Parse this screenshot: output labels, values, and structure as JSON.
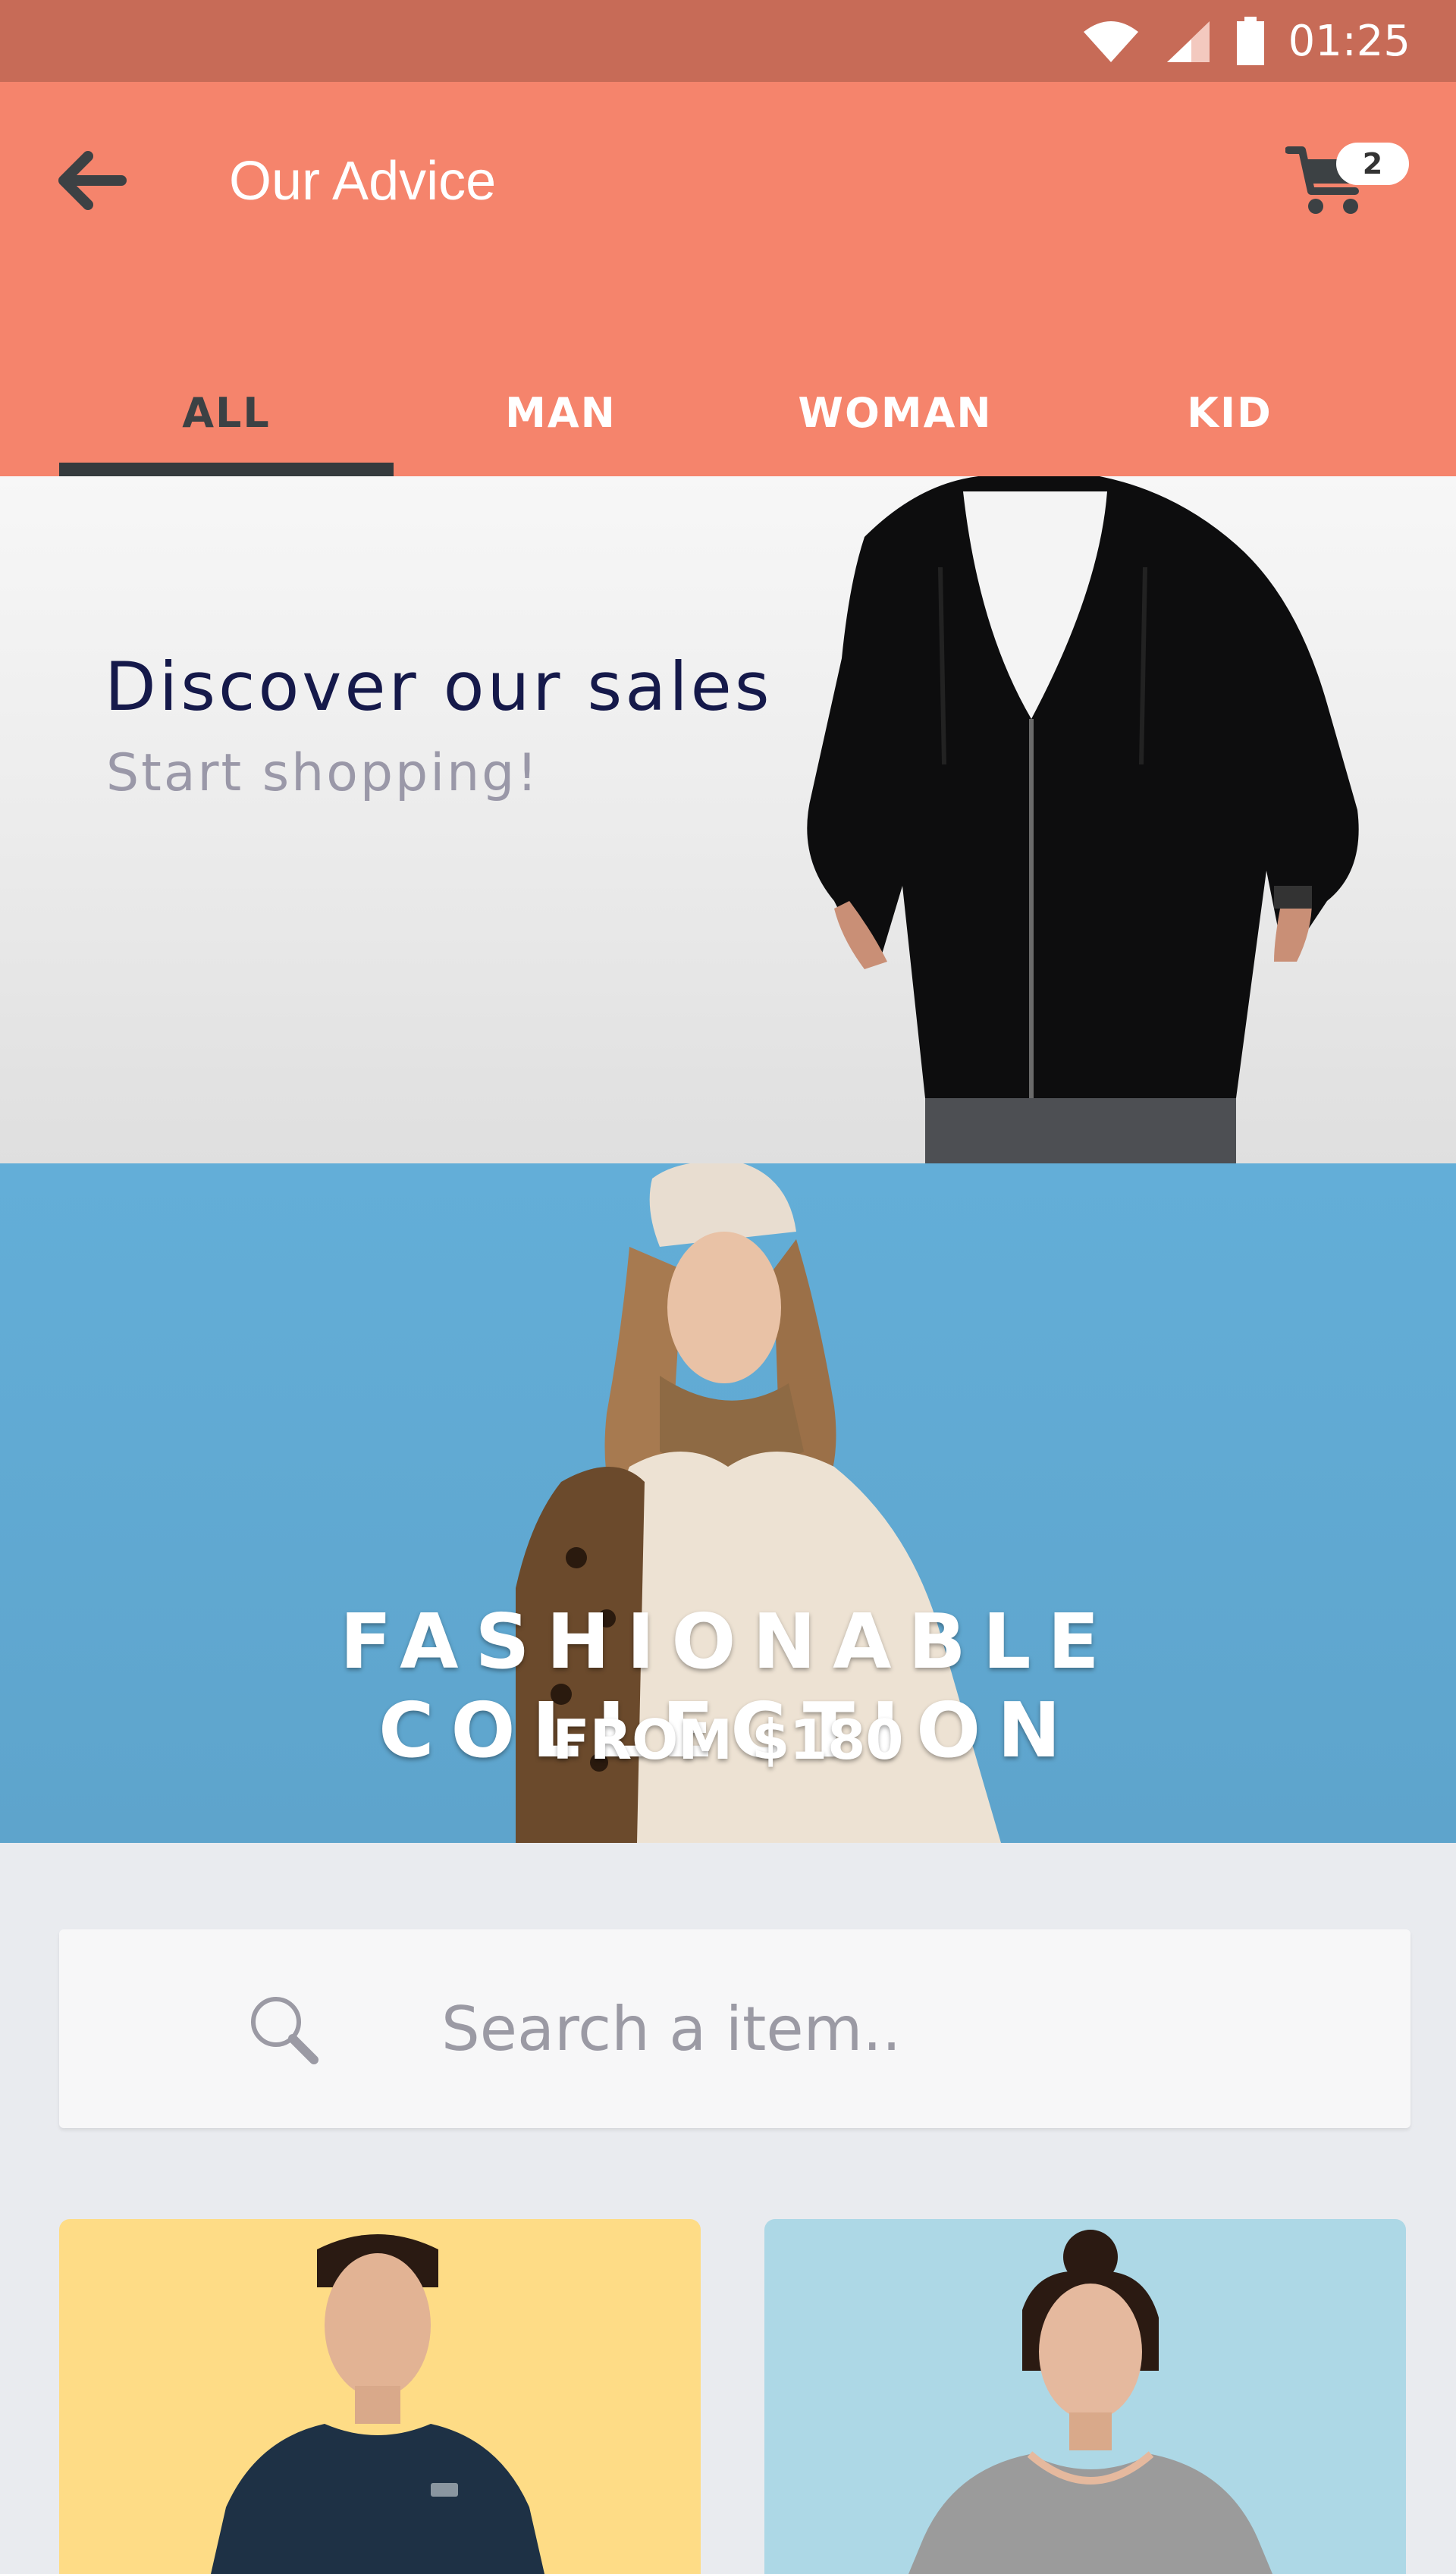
{
  "status_bar": {
    "time": "01:25",
    "icons": [
      "wifi-icon",
      "cell-signal-icon",
      "battery-icon"
    ]
  },
  "app_bar": {
    "title": "Our Advice",
    "cart_count": "2",
    "colors": {
      "status_bar": "#c76b57",
      "app_bar": "#f5846c",
      "tab_indicator": "#353a3d"
    }
  },
  "tabs": [
    {
      "label": "ALL",
      "active": true
    },
    {
      "label": "MAN",
      "active": false
    },
    {
      "label": "WOMAN",
      "active": false
    },
    {
      "label": "KID",
      "active": false
    }
  ],
  "banner_sales": {
    "title": "Discover our sales",
    "subtitle": "Start shopping!"
  },
  "banner_collection": {
    "title": "FASHIONABLE COLLECTION",
    "price_text": "FROM $180"
  },
  "search": {
    "placeholder": "Search a item.."
  },
  "products": [
    {
      "background": "#fedc86"
    },
    {
      "background": "#add8e6"
    }
  ]
}
